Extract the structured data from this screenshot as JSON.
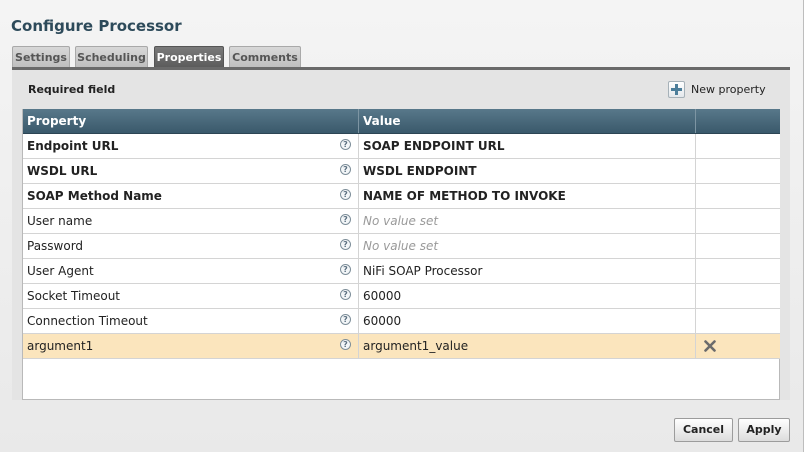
{
  "dialog": {
    "title": "Configure Processor"
  },
  "tabs": [
    {
      "label": "Settings"
    },
    {
      "label": "Scheduling"
    },
    {
      "label": "Properties",
      "active": true
    },
    {
      "label": "Comments"
    }
  ],
  "properties_panel": {
    "required_label": "Required field",
    "new_property_label": "New property",
    "columns": {
      "property": "Property",
      "value": "Value"
    },
    "rows": [
      {
        "name": "Endpoint URL",
        "value": "SOAP ENDPOINT URL",
        "required": true
      },
      {
        "name": "WSDL URL",
        "value": "WSDL ENDPOINT",
        "required": true
      },
      {
        "name": "SOAP Method Name",
        "value": "NAME OF METHOD TO INVOKE",
        "required": true
      },
      {
        "name": "User name",
        "value": "No value set",
        "unset": true
      },
      {
        "name": "Password",
        "value": "No value set",
        "unset": true
      },
      {
        "name": "User Agent",
        "value": "NiFi SOAP Processor"
      },
      {
        "name": "Socket Timeout",
        "value": "60000"
      },
      {
        "name": "Connection Timeout",
        "value": "60000"
      },
      {
        "name": "argument1",
        "value": "argument1_value",
        "selected": true,
        "deletable": true
      }
    ],
    "help_glyph": "?"
  },
  "footer": {
    "cancel_label": "Cancel",
    "apply_label": "Apply"
  },
  "colors": {
    "header": "#3a596b",
    "selected_row": "#fbe5bd",
    "title": "#2d4a5a"
  }
}
